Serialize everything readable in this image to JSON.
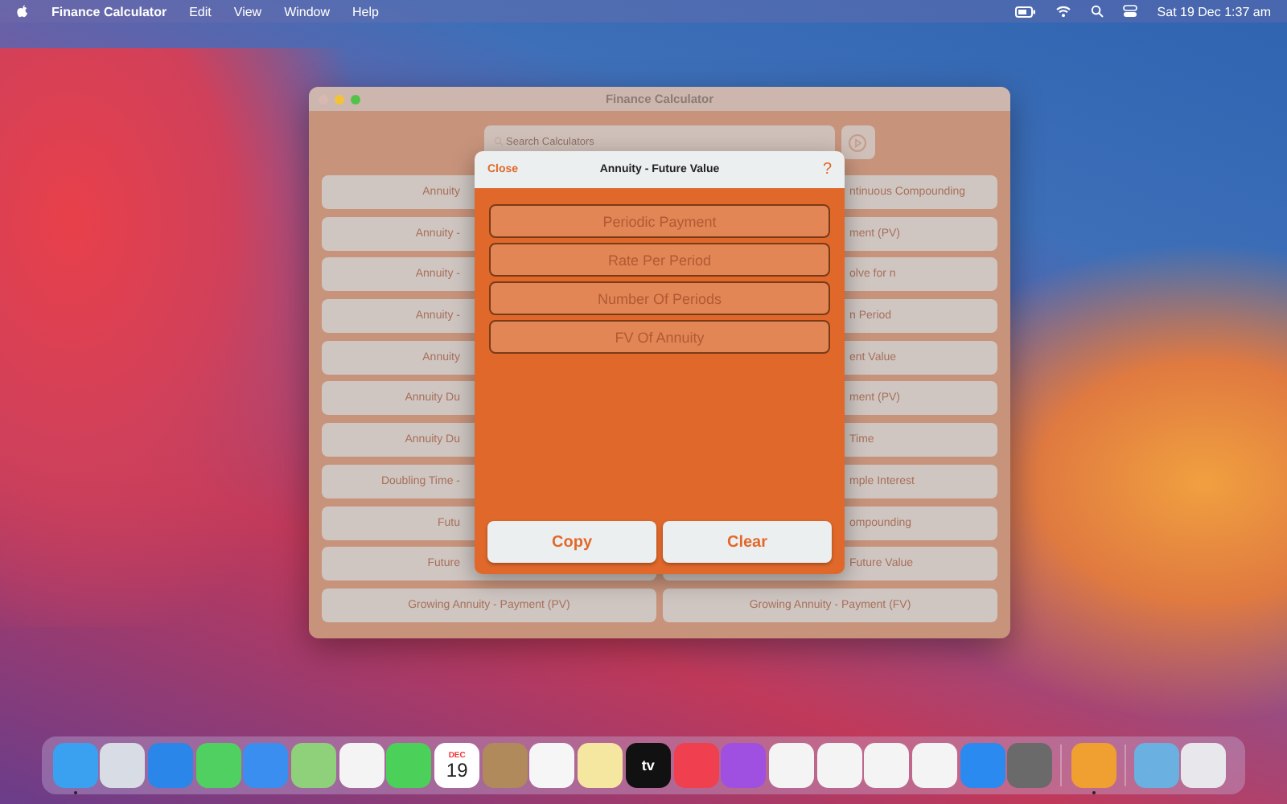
{
  "menu_bar": {
    "app": "Finance Calculator",
    "menus": [
      "Edit",
      "View",
      "Window",
      "Help"
    ],
    "clock": "Sat 19 Dec  1:37 am"
  },
  "window": {
    "title": "Finance Calculator",
    "search": {
      "placeholder": "Search Calculators"
    },
    "rows": [
      {
        "left": {
          "label": "Annuity",
          "kind": "cut"
        },
        "right": {
          "label": "ntinuous Compounding",
          "kind": "cut"
        }
      },
      {
        "left": {
          "label": "Annuity -",
          "kind": "cut"
        },
        "right": {
          "label": "ment (PV)",
          "kind": "cut"
        }
      },
      {
        "left": {
          "label": "Annuity -",
          "kind": "cut"
        },
        "right": {
          "label": "olve for n",
          "kind": "cut"
        }
      },
      {
        "left": {
          "label": "Annuity -",
          "kind": "cut"
        },
        "right": {
          "label": "n Period",
          "kind": "cut"
        }
      },
      {
        "left": {
          "label": "Annuity",
          "kind": "cut"
        },
        "right": {
          "label": "ent Value",
          "kind": "cut"
        }
      },
      {
        "left": {
          "label": "Annuity Du",
          "kind": "cut"
        },
        "right": {
          "label": "ment (PV)",
          "kind": "cut"
        }
      },
      {
        "left": {
          "label": "Annuity Du",
          "kind": "cut"
        },
        "right": {
          "label": "Time",
          "kind": "cut"
        }
      },
      {
        "left": {
          "label": "Doubling Time -",
          "kind": "cut"
        },
        "right": {
          "label": "mple Interest",
          "kind": "cut"
        }
      },
      {
        "left": {
          "label": "Futu",
          "kind": "cut"
        },
        "right": {
          "label": "ompounding",
          "kind": "cut"
        }
      },
      {
        "left": {
          "label": "Future",
          "kind": "cut"
        },
        "right": {
          "label": "Future Value",
          "kind": "cut"
        }
      },
      {
        "left": {
          "label": "Growing Annuity - Payment (PV)",
          "kind": "whole"
        },
        "right": {
          "label": "Growing Annuity - Payment (FV)",
          "kind": "whole"
        }
      }
    ]
  },
  "dialog": {
    "close": "Close",
    "title": "Annuity - Future Value",
    "help": "?",
    "fields": [
      {
        "placeholder": "Periodic Payment"
      },
      {
        "placeholder": "Rate Per Period"
      },
      {
        "placeholder": "Number Of Periods"
      },
      {
        "placeholder": "FV Of Annuity"
      }
    ],
    "buttons": [
      "Copy",
      "Clear"
    ]
  },
  "dock": {
    "calendar_month": "DEC",
    "calendar_day": "19",
    "tv_label": "tv"
  }
}
